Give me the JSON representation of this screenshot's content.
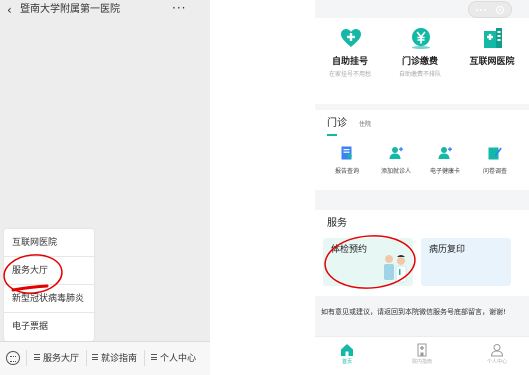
{
  "colors": {
    "teal": "#14b8a6",
    "annotation_red": "#e30000"
  },
  "left": {
    "header": {
      "back_icon": "chevron-left-icon",
      "title": "暨南大学附属第一医院",
      "more": "···"
    },
    "menu": {
      "items": [
        {
          "label": "互联网医院"
        },
        {
          "label": "服务大厅"
        },
        {
          "label": "新型冠状病毒肺炎"
        },
        {
          "label": "电子票据"
        }
      ]
    },
    "tabbar": {
      "keyboard_icon": "keyboard-icon",
      "tabs": [
        {
          "label": "服务大厅"
        },
        {
          "label": "就诊指南"
        },
        {
          "label": "个人中心"
        }
      ]
    }
  },
  "right": {
    "capsule": {
      "more_icon": "more-dots-icon",
      "close_icon": "close-circle-icon"
    },
    "top_tiles": [
      {
        "icon": "heart-plus-icon",
        "label": "自助挂号",
        "sub": "在家挂号不用愁"
      },
      {
        "icon": "yen-coin-icon",
        "label": "门诊缴费",
        "sub": "自助缴费不排队"
      },
      {
        "icon": "hospital-building-icon",
        "label": "互联网医院",
        "sub": ""
      }
    ],
    "clinic": {
      "tab_active": "门诊",
      "tab_inactive": "住院",
      "functions": [
        {
          "icon": "report-icon",
          "label": "报告查询"
        },
        {
          "icon": "add-person-icon",
          "label": "添加就诊人"
        },
        {
          "icon": "health-card-icon",
          "label": "电子健康卡"
        },
        {
          "icon": "survey-edit-icon",
          "label": "问卷调查"
        }
      ]
    },
    "service": {
      "title": "服务",
      "cards": [
        {
          "label": "体检预约"
        },
        {
          "label": "病历复印"
        }
      ]
    },
    "notice": {
      "text": "如有意见或建议，请返回到本院微信服务号底部留言，谢谢!"
    },
    "bottom_nav": [
      {
        "icon": "home-icon",
        "label": "首页",
        "active": true
      },
      {
        "icon": "hospital-guide-icon",
        "label": "院内指南",
        "active": false
      },
      {
        "icon": "person-icon",
        "label": "个人中心",
        "active": false
      }
    ]
  }
}
